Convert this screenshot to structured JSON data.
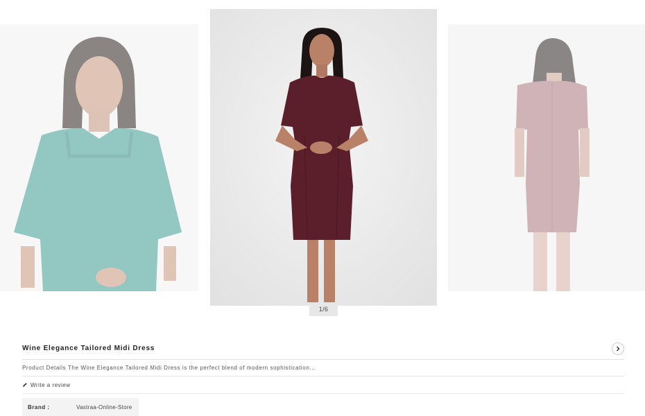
{
  "gallery": {
    "counter": "1/6",
    "slides": [
      {
        "id": "prev",
        "description": "teal top front view"
      },
      {
        "id": "active",
        "description": "wine midi dress front view"
      },
      {
        "id": "next",
        "description": "wine midi dress back view"
      }
    ]
  },
  "product": {
    "title": "Wine Elegance Tailored Midi Dress",
    "description": "Product Details The Wine Elegance Tailored Midi Dress is the perfect blend of modern sophistication...",
    "write_review_label": "Write a review",
    "brand_label": "Brand :",
    "brand_value": "Vastraa-Online-Store"
  },
  "colors": {
    "teal_top": "#3a9a91",
    "wine_dress": "#5a1f2a",
    "faded_dress": "#a9757d"
  },
  "icons": {
    "next": "chevron-right-icon",
    "review": "pencil-icon"
  }
}
